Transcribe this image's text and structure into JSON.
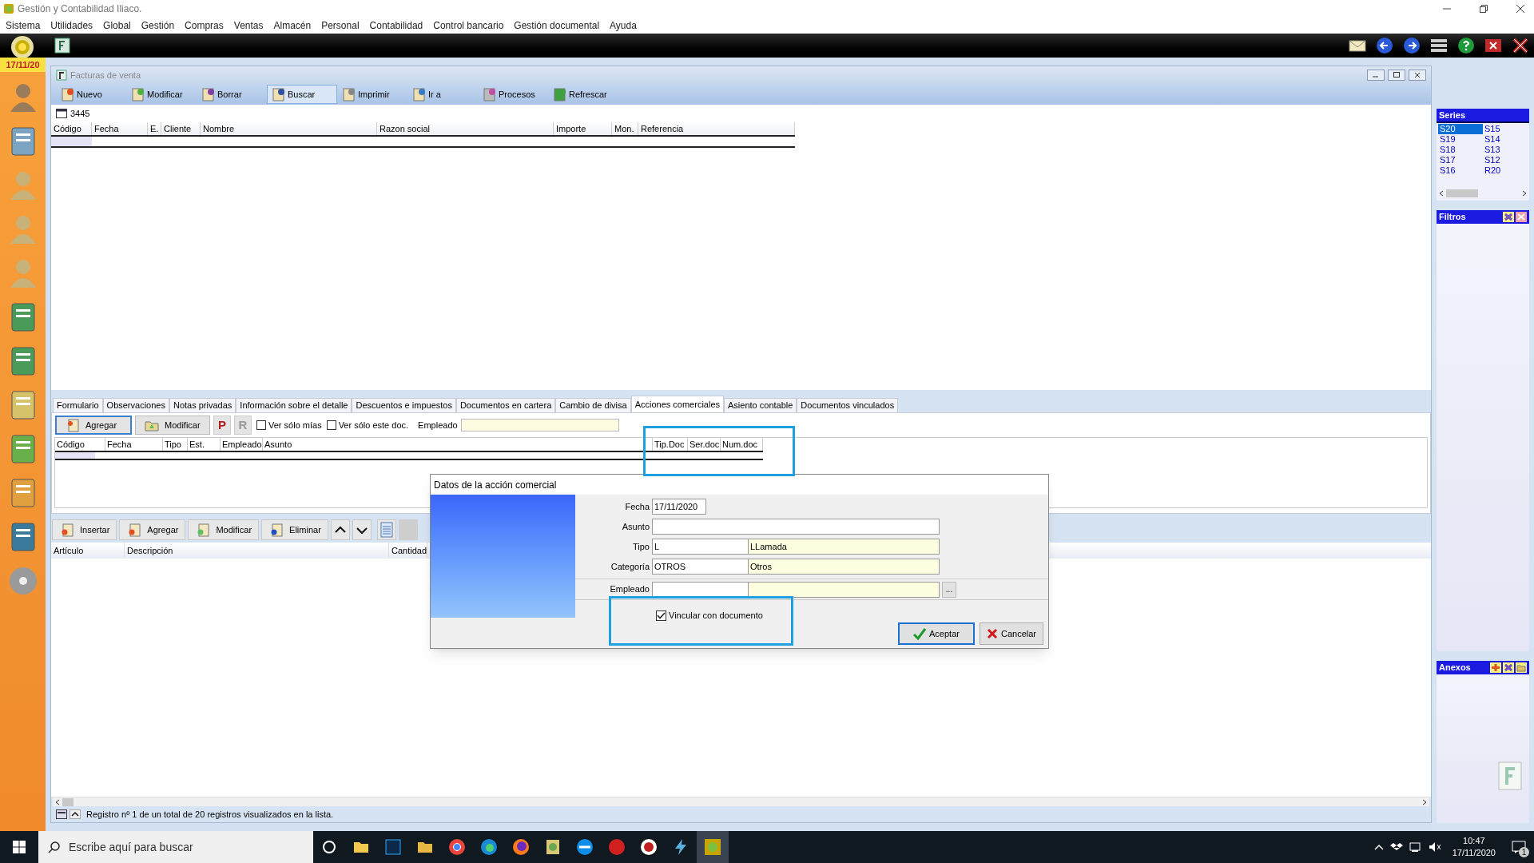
{
  "app_title": "Gestión y Contabilidad Iliaco.",
  "menu": [
    "Sistema",
    "Utilidades",
    "Global",
    "Gestión",
    "Compras",
    "Ventas",
    "Almacén",
    "Personal",
    "Contabilidad",
    "Control bancario",
    "Gestión documental",
    "Ayuda"
  ],
  "sidebar_date": "17/11/20",
  "window": {
    "title": "Facturas de venta"
  },
  "toolbar": [
    "Nuevo",
    "Modificar",
    "Borrar",
    "Buscar",
    "Imprimir",
    "Ir a",
    "Procesos",
    "Refrescar"
  ],
  "record_number": "3445",
  "table": {
    "columns": [
      "Código",
      "Fecha",
      "E.",
      "Cliente",
      "Nombre",
      "Razon social",
      "Importe",
      "Mon.",
      "Referencia"
    ]
  },
  "tabs": [
    {
      "label": "Formulario",
      "selected": false
    },
    {
      "label": "Observaciones",
      "selected": false
    },
    {
      "label": "Notas privadas",
      "selected": false
    },
    {
      "label": "Información sobre el detalle",
      "selected": false
    },
    {
      "label": "Descuentos e impuestos",
      "selected": false
    },
    {
      "label": "Documentos en cartera",
      "selected": false
    },
    {
      "label": "Cambio de divisa",
      "selected": false
    },
    {
      "label": "Acciones comerciales",
      "selected": true
    },
    {
      "label": "Asiento contable",
      "selected": false
    },
    {
      "label": "Documentos vinculados",
      "selected": false
    }
  ],
  "actions": {
    "buttons": [
      "Agregar",
      "Modificar"
    ],
    "letter_buttons": [
      "P",
      "R"
    ],
    "checkboxes": [
      {
        "label": "Ver sólo mías",
        "checked": false
      },
      {
        "label": "Ver sólo este doc.",
        "checked": false
      }
    ],
    "employee_label": "Empleado",
    "columns": [
      "Código",
      "Fecha",
      "Tipo",
      "Est.",
      "Empleado",
      "Asunto",
      "Tip.Doc",
      "Ser.doc",
      "Num.doc"
    ]
  },
  "lines": {
    "buttons": [
      "Insertar",
      "Agregar",
      "Modificar",
      "Eliminar"
    ],
    "columns": [
      "Artículo",
      "Descripción",
      "Cantidad"
    ]
  },
  "status_bar": "Registro nº 1 de un total de 20 registros visualizados en la lista.",
  "series": {
    "title": "Series",
    "items": [
      {
        "label": "S20",
        "selected": true
      },
      {
        "label": "S15",
        "selected": false
      },
      {
        "label": "S19",
        "selected": false
      },
      {
        "label": "S14",
        "selected": false
      },
      {
        "label": "S18",
        "selected": false
      },
      {
        "label": "S13",
        "selected": false
      },
      {
        "label": "S17",
        "selected": false
      },
      {
        "label": "S12",
        "selected": false
      },
      {
        "label": "S16",
        "selected": false
      },
      {
        "label": "R20",
        "selected": false
      }
    ]
  },
  "filters": {
    "title": "Filtros"
  },
  "attachments": {
    "title": "Anexos"
  },
  "dialog": {
    "title": "Datos de la acción comercial",
    "fields": [
      {
        "label": "Fecha",
        "kind": "date",
        "value": "17/11/2020"
      },
      {
        "label": "Asunto",
        "kind": "text"
      },
      {
        "label": "Tipo",
        "kind": "pair",
        "code": "L",
        "description": "LLamada"
      },
      {
        "label": "Categoría",
        "kind": "pair",
        "code": "OTROS",
        "description": "Otros"
      },
      {
        "label": "Empleado",
        "kind": "lookup",
        "lookup_button": "..."
      }
    ],
    "link_checkbox": {
      "label": "Vincular con documento",
      "checked": true
    },
    "buttons": [
      "Aceptar",
      "Cancelar"
    ]
  },
  "taskbar": {
    "search_placeholder": "Escribe aquí para buscar",
    "time": "10:47",
    "date": "17/11/2020",
    "notifications": "1"
  }
}
